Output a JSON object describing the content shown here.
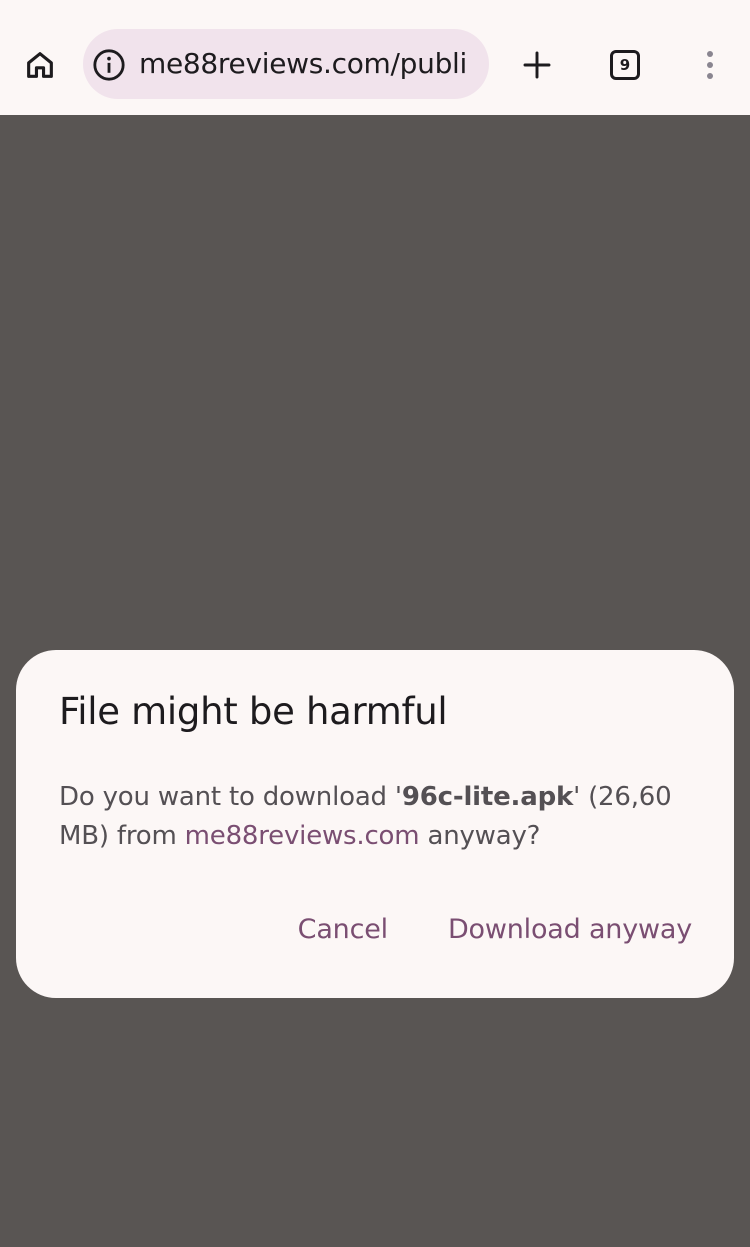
{
  "browser": {
    "url": "me88reviews.com/publi",
    "tab_count": "9",
    "icons": {
      "home": "home-icon",
      "site_info": "info-icon",
      "new_tab": "plus-icon",
      "tabs": "tab-switcher-icon",
      "menu": "more-vert-icon"
    }
  },
  "dialog": {
    "title": "File might be harmful",
    "message_before": "Do you want to download '",
    "filename": "96c-lite.apk",
    "message_middle": "' (26,60 MB) from ",
    "domain": "me88reviews.com",
    "message_after": " anyway?",
    "cancel_label": "Cancel",
    "confirm_label": "Download anyway"
  },
  "colors": {
    "scrim": "#595553",
    "toolbar_bg": "#fcf7f6",
    "omnibox_bg": "#f1e3ec",
    "accent": "#7a4e72",
    "text_primary": "#1d1b1e",
    "text_secondary": "#545054"
  }
}
